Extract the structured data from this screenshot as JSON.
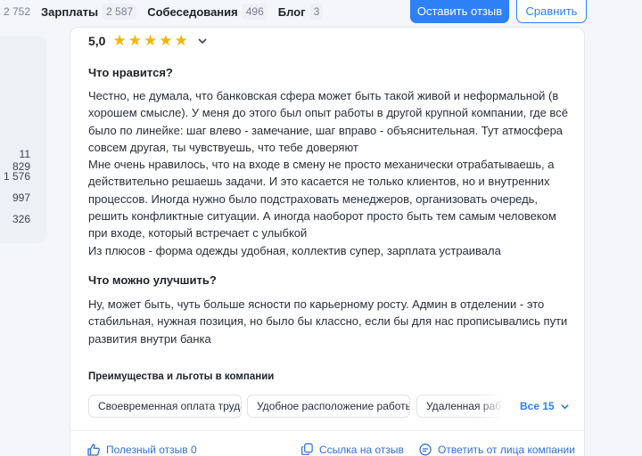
{
  "tabs": [
    {
      "label": "",
      "count": "2 752"
    },
    {
      "label": "Зарплаты",
      "count": "2 587"
    },
    {
      "label": "Собеседования",
      "count": "496"
    },
    {
      "label": "Блог",
      "count": "3"
    }
  ],
  "header": {
    "leave_review": "Оставить отзыв",
    "compare": "Сравнить"
  },
  "sidebar": {
    "numbers": [
      "11 829",
      "1 576",
      "997",
      "326"
    ]
  },
  "review": {
    "rating": "5,0",
    "stars": 5,
    "likes_title": "Что нравится?",
    "likes_lines": [
      "Честно, не думала, что банковская сфера может быть такой живой и неформальной (в",
      "хорошем смысле). У меня до этого был опыт работы в другой крупной компании, где всё",
      "было по линейке: шаг влево - замечание, шаг вправо - объяснительная. Тут атмосфера",
      "совсем другая, ты чувствуешь, что тебе доверяют",
      "Мне очень нравилось, что на входе в смену не просто механически отрабатываешь, а",
      "действительно решаешь задачи. И это касается не только клиентов, но и внутренних",
      "процессов. Иногда нужно было подстраховать менеджеров, организовать очередь,",
      "решить конфликтные ситуации. А иногда наоборот просто быть тем самым человеком",
      "при входе, который встречает с улыбкой",
      "Из плюсов - форма одежды удобная, коллектив супер, зарплата устраивала"
    ],
    "improve_title": "Что можно улучшить?",
    "improve_lines": [
      "Ну, может быть, чуть больше ясности по карьерному росту. Админ в отделении - это",
      "стабильная, нужная позиция, но было бы классно, если бы для нас прописывались пути",
      "развития внутри банка"
    ],
    "benefits_title": "Преимущества и льготы в компании",
    "benefits": [
      "Своевременная оплата труда",
      "Удобное расположение работы",
      "Удаленная раб"
    ],
    "benefits_more": "Все 15",
    "useful": "Полезный отзыв 0",
    "link": "Ссылка на отзыв",
    "reply": "Ответить от лица компании"
  },
  "colors": {
    "accent": "#2d80f5",
    "star": "#f7b500"
  }
}
